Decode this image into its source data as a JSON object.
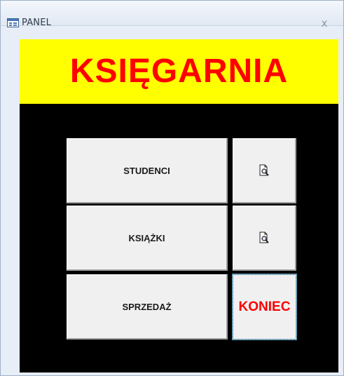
{
  "window": {
    "title": "PANEL",
    "close_glyph": "x"
  },
  "header": {
    "title": "KSIĘGARNIA",
    "bg_color": "#ffff00",
    "text_color": "#ff0000"
  },
  "buttons": {
    "studenci": {
      "label": "STUDENCI"
    },
    "studenci_preview": {
      "icon": "print-preview-icon"
    },
    "ksiazki": {
      "label": "KSIĄŻKI"
    },
    "ksiazki_preview": {
      "icon": "print-preview-icon"
    },
    "sprzedaz": {
      "label": "SPRZEDAŻ"
    },
    "koniec": {
      "label": "KONIEC",
      "text_color": "#ff0000"
    }
  },
  "colors": {
    "form_background": "#000000",
    "button_face": "#f0f0f0"
  }
}
